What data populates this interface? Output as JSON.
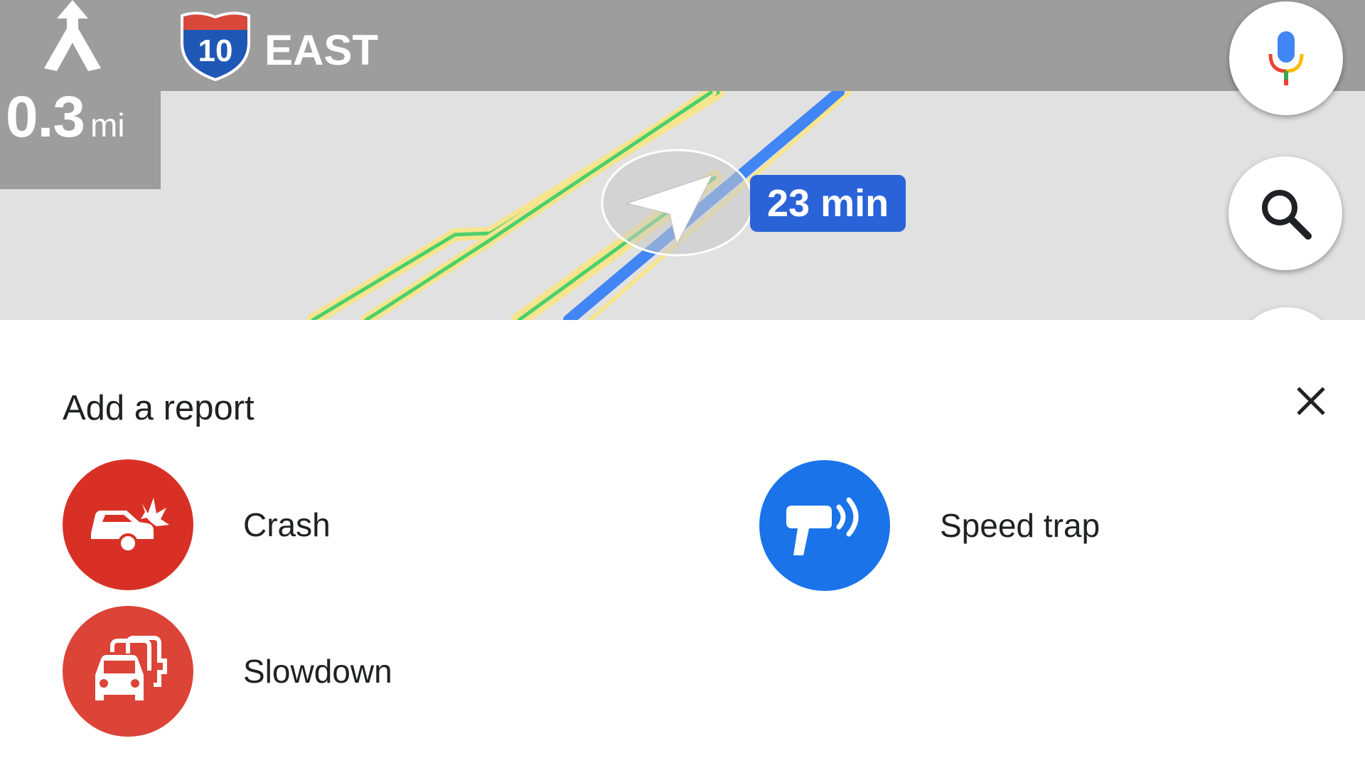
{
  "navigation": {
    "maneuver": {
      "icon": "fork-left-arrow-icon",
      "distance_value": "0.3",
      "distance_unit": "mi"
    },
    "route": {
      "shield_icon": "interstate-shield-icon",
      "shield_number": "10",
      "direction_label": "EAST"
    },
    "eta_badge": "23 min",
    "buttons": {
      "voice": {
        "icon": "microphone-icon"
      },
      "search": {
        "icon": "search-icon"
      }
    }
  },
  "report_sheet": {
    "title": "Add a report",
    "close_icon": "close-icon",
    "options": [
      {
        "label": "Crash",
        "icon": "crash-icon",
        "color": "#d93025"
      },
      {
        "label": "Slowdown",
        "icon": "slowdown-icon",
        "color": "#db4437"
      },
      {
        "label": "Speed trap",
        "icon": "speed-trap-icon",
        "color": "#1a73e8"
      }
    ]
  },
  "colors": {
    "nav_bar": "#9d9d9d",
    "map_background": "#e1e1e1",
    "route_blue": "#4285f4",
    "eta_blue": "#2a63d8",
    "road_yellow": "#f6e48e",
    "road_green": "#4bd06b"
  }
}
